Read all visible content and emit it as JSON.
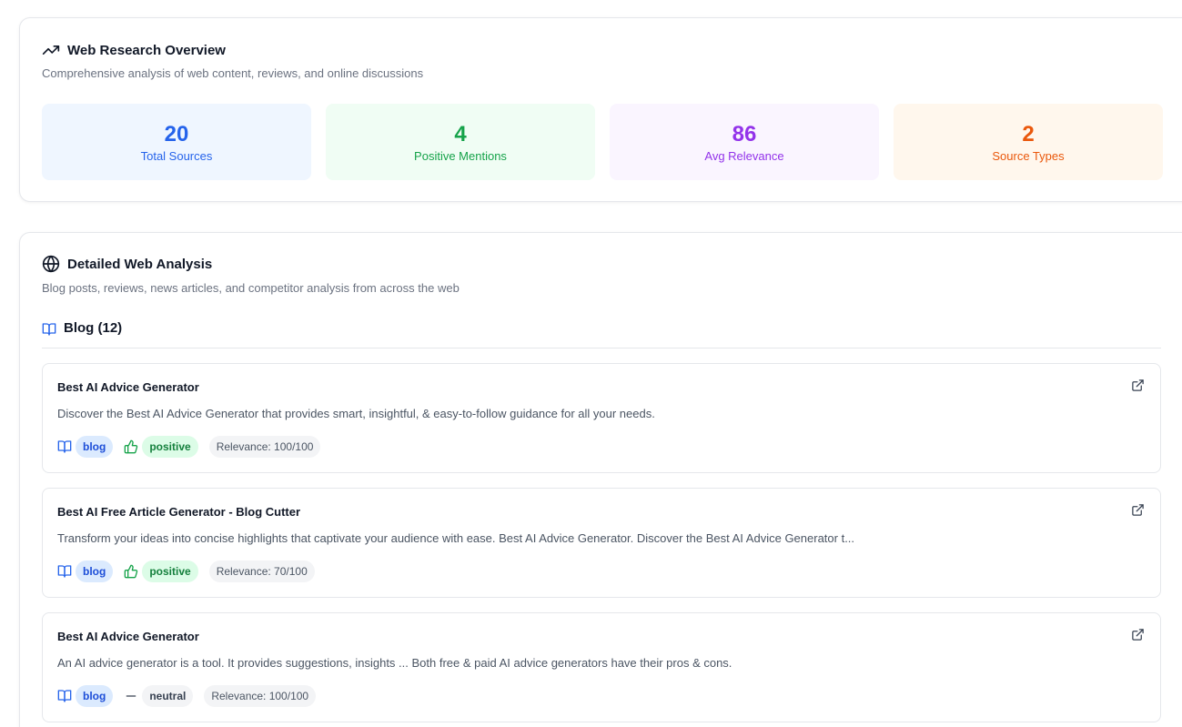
{
  "overview": {
    "title": "Web Research Overview",
    "description": "Comprehensive analysis of web content, reviews, and online discussions",
    "stats": [
      {
        "value": "20",
        "label": "Total Sources",
        "color": "#2563eb",
        "bg": "#eff6ff"
      },
      {
        "value": "4",
        "label": "Positive Mentions",
        "color": "#16a34a",
        "bg": "#f0fdf4"
      },
      {
        "value": "86",
        "label": "Avg Relevance",
        "color": "#9333ea",
        "bg": "#faf5ff"
      },
      {
        "value": "2",
        "label": "Source Types",
        "color": "#ea580c",
        "bg": "#fff7ed"
      }
    ],
    "icon": "trending-up-icon"
  },
  "detail": {
    "title": "Detailed Web Analysis",
    "description": "Blog posts, reviews, news articles, and competitor analysis from across the web",
    "icon": "globe-icon",
    "section": {
      "label": "Blog (12)",
      "icon": "book-open-icon"
    },
    "items": [
      {
        "title": "Best AI Advice Generator",
        "description": "Discover the Best AI Advice Generator that provides smart, insightful, & easy-to-follow guidance for all your needs.",
        "type": "blog",
        "sentiment": "positive",
        "relevance": "Relevance: 100/100"
      },
      {
        "title": "Best AI Free Article Generator - Blog Cutter",
        "description": "Transform your ideas into concise highlights that captivate your audience with ease. Best AI Advice Generator. Discover the Best AI Advice Generator t...",
        "type": "blog",
        "sentiment": "positive",
        "relevance": "Relevance: 70/100"
      },
      {
        "title": "Best AI Advice Generator",
        "description": "An AI advice generator is a tool. It provides suggestions, insights ... Both free & paid AI advice generators have their pros & cons.",
        "type": "blog",
        "sentiment": "neutral",
        "relevance": "Relevance: 100/100"
      }
    ]
  },
  "colors": {
    "blue": "#2563eb",
    "green": "#16a34a",
    "neutral": "#374151"
  }
}
